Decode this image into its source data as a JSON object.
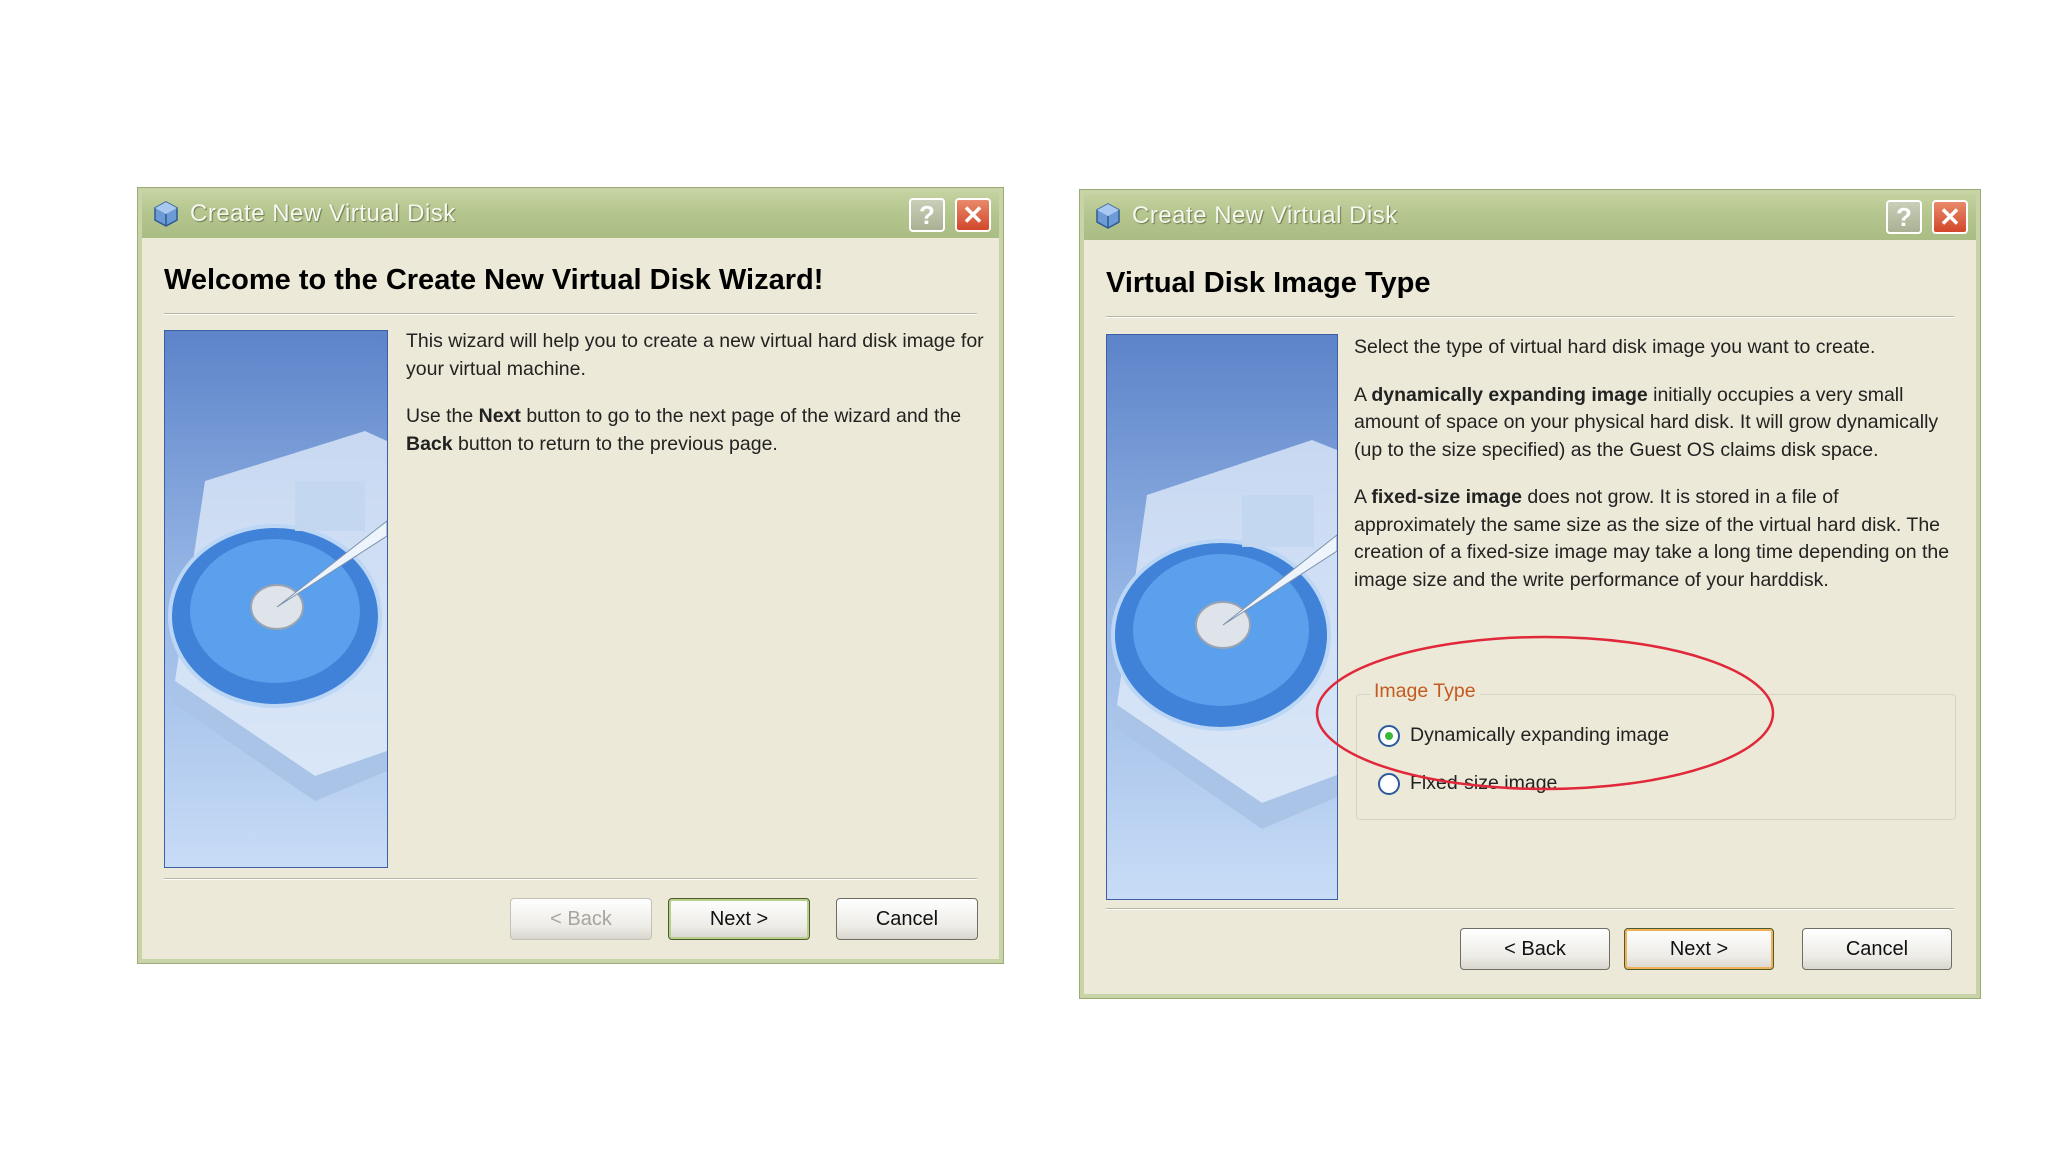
{
  "window1": {
    "title": "Create New Virtual Disk",
    "heading": "Welcome to the Create New Virtual Disk Wizard!",
    "para1": "This wizard will help you to create a new virtual hard disk image for your virtual machine.",
    "para2_parts": [
      "Use the ",
      "Next",
      " button to go to the next page of the wizard and the ",
      "Back",
      " button to return to the previous page."
    ],
    "buttons": {
      "back": "< Back",
      "next": "Next >",
      "cancel": "Cancel"
    }
  },
  "window2": {
    "title": "Create New Virtual Disk",
    "heading": "Virtual Disk Image Type",
    "intro": "Select the type of virtual hard disk image you want to create.",
    "dyn_parts": [
      "A ",
      "dynamically expanding image",
      " initially occupies a very small amount of space on your physical hard disk. It will grow dynamically (up to the size specified) as the Guest OS claims disk space."
    ],
    "fixed_parts": [
      "A ",
      "fixed-size image",
      " does not grow. It is stored in a file of approximately the same size as the size of the virtual hard disk. The creation of a fixed-size image may take a long time depending on the image size and the write performance of your harddisk."
    ],
    "group_label": "Image Type",
    "options": [
      {
        "label": "Dynamically expanding image",
        "selected": true
      },
      {
        "label": "Fixed-size image",
        "selected": false
      }
    ],
    "buttons": {
      "back": "< Back",
      "next": "Next >",
      "cancel": "Cancel"
    }
  },
  "colors": {
    "annotation_ellipse": "#e0283a",
    "titlebar": "#b3c48c",
    "dialog_bg": "#ece9d8"
  },
  "icons": {
    "title": "virtualbox-cube-icon",
    "help": "help-icon",
    "close": "close-icon",
    "side": "hard-disk-illustration"
  }
}
